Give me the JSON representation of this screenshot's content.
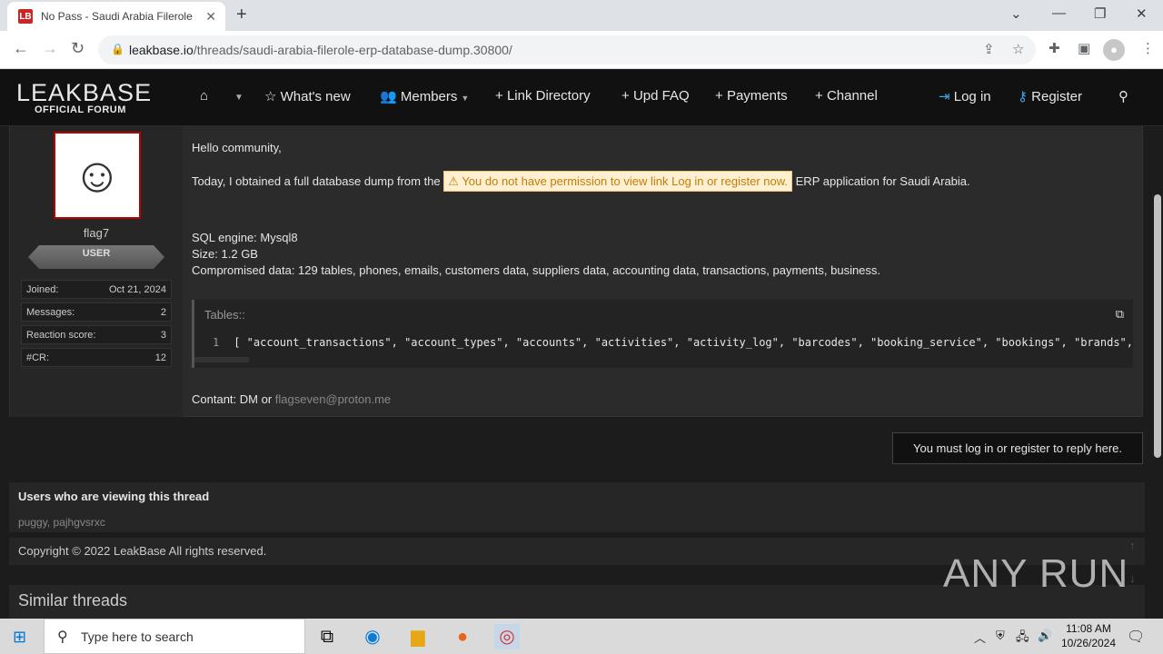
{
  "browser": {
    "tab_title": "No Pass - Saudi Arabia Filerole E",
    "favicon_text": "LB",
    "url_domain": "leakbase.io",
    "url_path": "/threads/saudi-arabia-filerole-erp-database-dump.30800/"
  },
  "site": {
    "logo_main": "LEAKBASE",
    "logo_sub": "OFFICIAL FORUM",
    "nav": [
      {
        "label": "What's new"
      },
      {
        "label": "Members"
      },
      {
        "label": "Link Directory"
      },
      {
        "label": "Upd FAQ"
      },
      {
        "label": "Payments"
      },
      {
        "label": "Channel"
      }
    ],
    "login_label": "Log in",
    "register_label": "Register"
  },
  "post": {
    "author": "flag7",
    "badge": "USER",
    "stats": [
      {
        "label": "Joined:",
        "value": "Oct 21, 2024"
      },
      {
        "label": "Messages:",
        "value": "2"
      },
      {
        "label": "Reaction score:",
        "value": "3"
      },
      {
        "label": "#CR:",
        "value": "12"
      }
    ],
    "greeting": "Hello community,",
    "intro_before": "Today, I obtained a full database dump from the",
    "warning_text": "You do not have permission to view link",
    "warning_link": "Log in or register now.",
    "intro_after": "ERP application for Saudi Arabia.",
    "sql_engine": "SQL engine: Mysql8",
    "size": "Size: 1.2 GB",
    "compromised": "Compromised data: 129 tables, phones, emails, customers data, suppliers data, accounting data, transactions, payments, business.",
    "code_title": "Tables::",
    "code_line_num": "1",
    "code_content": "[ \"account_transactions\", \"account_types\", \"accounts\", \"activities\", \"activity_log\", \"barcodes\", \"booking_service\", \"bookings\", \"brands\", \"business\",",
    "contact_prefix": "Contant: DM or",
    "contact_email": "flagseven@proton.me"
  },
  "reply_notice": "You must log in or register to reply here.",
  "viewing": {
    "title": "Users who are viewing this thread",
    "user1": "puggy",
    "separator": ",",
    "user2": "pajhgvsrxc"
  },
  "copyright": "Copyright © 2022 LeakBase All rights reserved.",
  "similar_title": "Similar threads",
  "watermark": "ANY RUN",
  "taskbar": {
    "search_placeholder": "Type here to search",
    "time": "11:08 AM",
    "date": "10/26/2024"
  }
}
